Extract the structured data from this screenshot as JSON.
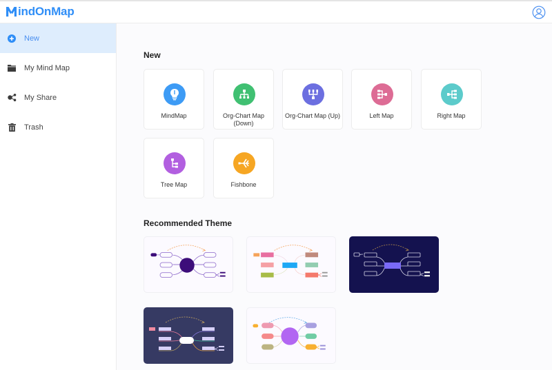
{
  "app": {
    "logo_text": "indOnMap",
    "logo_mark": "M",
    "brand_color": "#2f8ef7"
  },
  "header": {
    "user_icon": "user-circle-icon"
  },
  "sidebar": {
    "items": [
      {
        "label": "New",
        "icon": "plus-circle-icon",
        "active": true
      },
      {
        "label": "My Mind Map",
        "icon": "folder-icon",
        "active": false
      },
      {
        "label": "My Share",
        "icon": "share-icon",
        "active": false
      },
      {
        "label": "Trash",
        "icon": "trash-icon",
        "active": false
      }
    ]
  },
  "new_section": {
    "title": "New",
    "templates": [
      {
        "label": "MindMap",
        "icon": "lightbulb-icon",
        "color": "#3d9bf5"
      },
      {
        "label": "Org-Chart Map (Down)",
        "label_line1": "Org-Chart Map",
        "label_line2": "(Down)",
        "icon": "org-chart-down-icon",
        "color": "#40c072"
      },
      {
        "label": "Org-Chart Map (Up)",
        "icon": "org-chart-up-icon",
        "color": "#6c6fe0"
      },
      {
        "label": "Left Map",
        "icon": "left-map-icon",
        "color": "#dd6c95"
      },
      {
        "label": "Right Map",
        "icon": "right-map-icon",
        "color": "#5ccbcb"
      },
      {
        "label": "Tree Map",
        "icon": "tree-map-icon",
        "color": "#b25fe0"
      },
      {
        "label": "Fishbone",
        "icon": "fishbone-icon",
        "color": "#f6a623"
      }
    ]
  },
  "theme_section": {
    "title": "Recommended Theme",
    "themes": [
      {
        "name": "purple-classic",
        "background": "#fcfaff",
        "center_color": "#3d0d7a"
      },
      {
        "name": "colorful-blocks",
        "background": "#fcfaff",
        "center_color": "#1da8f5"
      },
      {
        "name": "dark-navy",
        "background": "#14124f",
        "center_color": "#7a6af7"
      },
      {
        "name": "slate-dark",
        "background": "#363a63",
        "center_color": "#ffffff"
      },
      {
        "name": "pastel-purple",
        "background": "#fcfaff",
        "center_color": "#b266f2"
      }
    ]
  }
}
